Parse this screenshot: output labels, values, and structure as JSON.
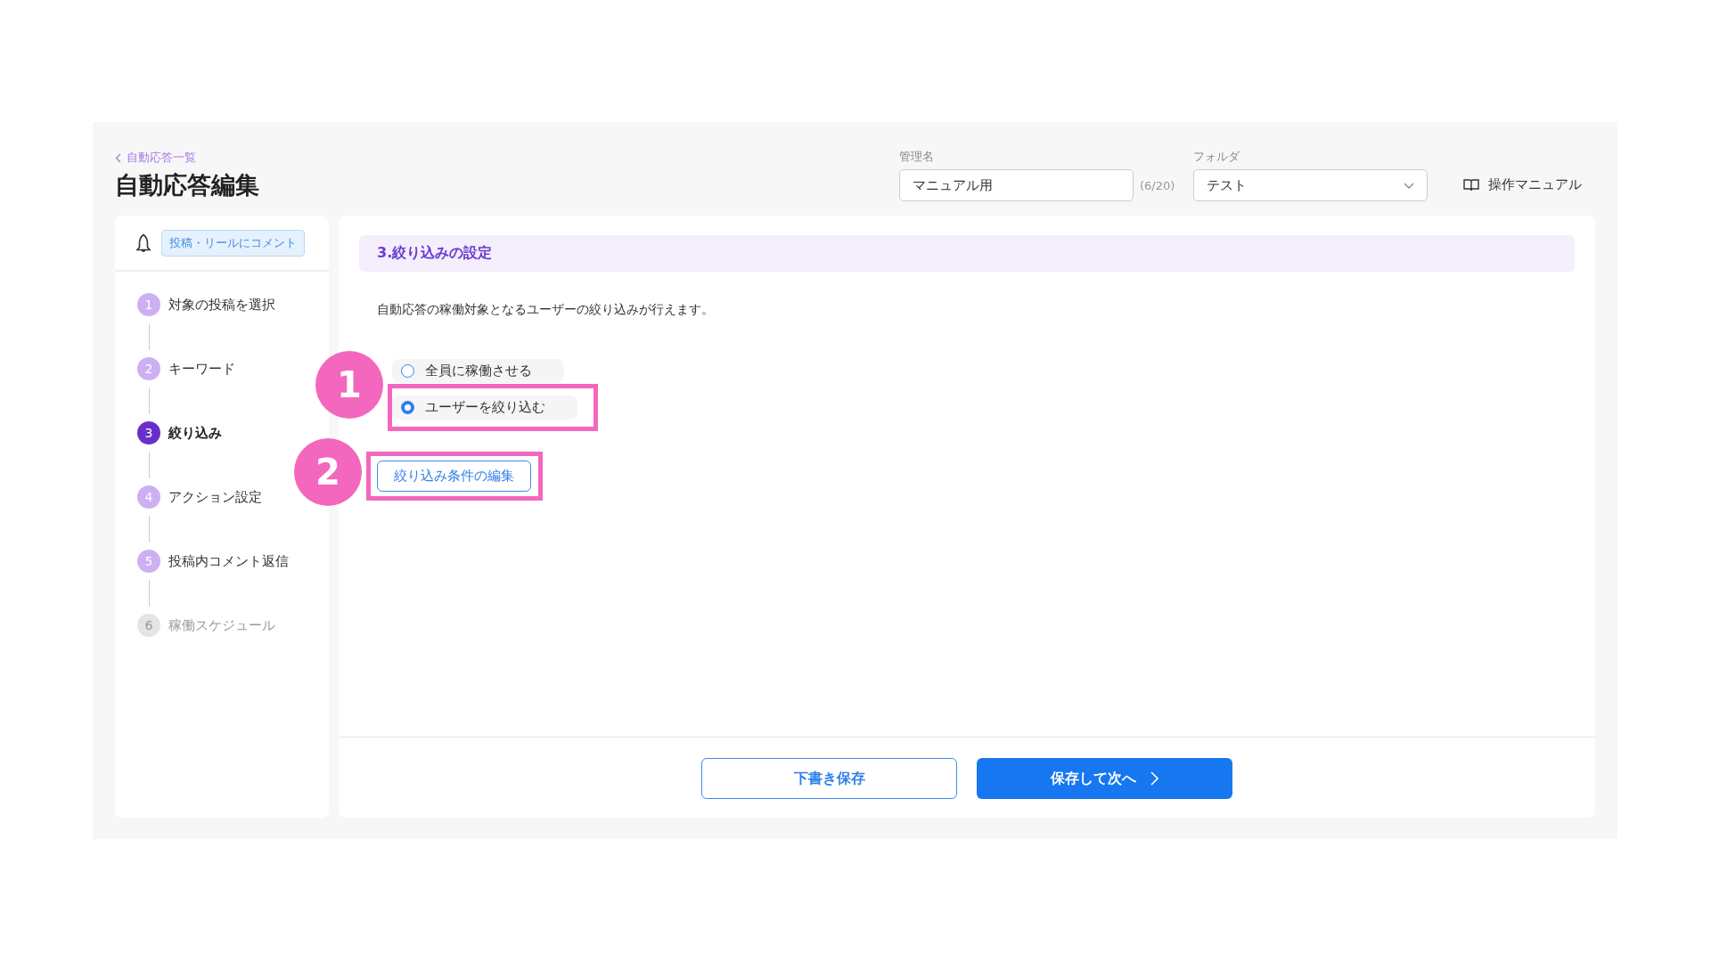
{
  "header": {
    "back_link": "自動応答一覧",
    "title": "自動応答編集",
    "name_field": {
      "label": "管理名",
      "value": "マニュアル用",
      "counter": "(6/20)"
    },
    "folder_field": {
      "label": "フォルダ",
      "value": "テスト"
    },
    "manual_link": "操作マニュアル"
  },
  "sidebar": {
    "type_tag": "投稿・リールにコメント",
    "steps": [
      {
        "number": "1",
        "label": "対象の投稿を選択",
        "selected": false,
        "disabled": false
      },
      {
        "number": "2",
        "label": "キーワード",
        "selected": false,
        "disabled": false
      },
      {
        "number": "3",
        "label": "絞り込み",
        "selected": true,
        "disabled": false
      },
      {
        "number": "4",
        "label": "アクション設定",
        "selected": false,
        "disabled": false
      },
      {
        "number": "5",
        "label": "投稿内コメント返信",
        "selected": false,
        "disabled": false
      },
      {
        "number": "6",
        "label": "稼働スケジュール",
        "selected": false,
        "disabled": true
      }
    ]
  },
  "panel": {
    "section_title": "3.絞り込みの設定",
    "description": "自動応答の稼働対象となるユーザーの絞り込みが行えます。",
    "options": [
      {
        "label": "全員に稼働させる",
        "selected": false
      },
      {
        "label": "ユーザーを絞り込む",
        "selected": true,
        "annotation": "1"
      }
    ],
    "edit_button": {
      "label": "絞り込み条件の編集",
      "annotation": "2"
    }
  },
  "footer": {
    "draft_button": "下書き保存",
    "next_button": "保存して次へ"
  }
}
